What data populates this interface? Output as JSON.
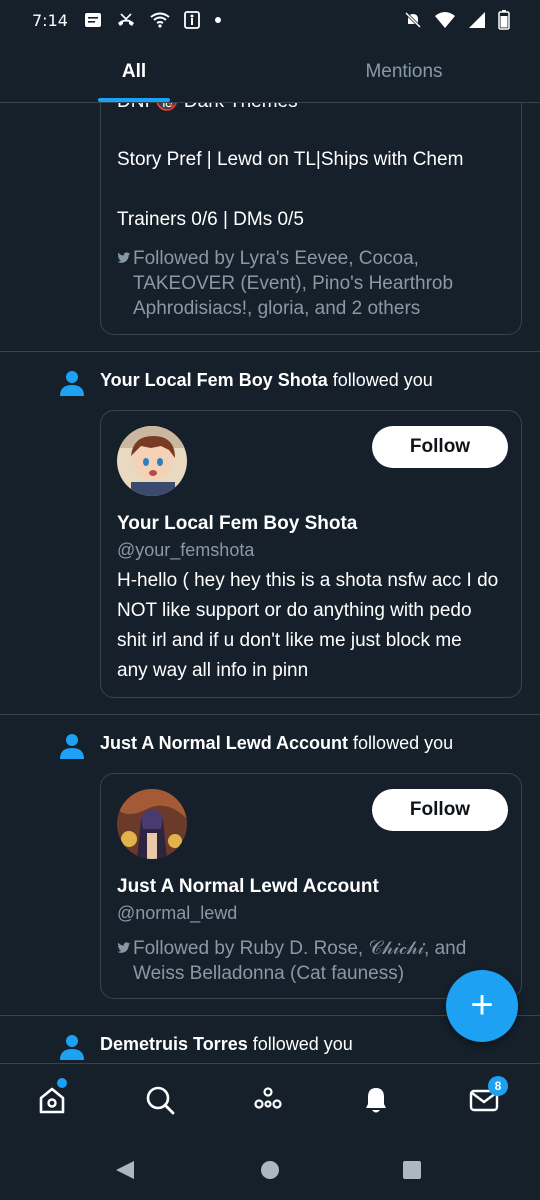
{
  "status_bar": {
    "time": "7:14"
  },
  "tabs": [
    {
      "label": "All"
    },
    {
      "label": "Mentions"
    }
  ],
  "truncated_card": {
    "top_line": "DNI 🔞 Dark Themes",
    "bio_lines": [
      "Story Pref | Lewd on TL|Ships with Chem",
      "Trainers 0/6 | DMs 0/5"
    ],
    "followed_by": [
      "Followed by Lyra's Eevee, Cocoa,",
      "TAKEOVER (Event), Pino's Hearthrob",
      "Aphrodisiacs!, gloria, and 2 others"
    ]
  },
  "notifications": [
    {
      "actor": "Your Local Fem Boy Shota",
      "action": "followed you",
      "card": {
        "name": "Your Local Fem Boy Shota",
        "handle": "@your_femshota",
        "bio_lines": [
          "H-hello ( hey hey this is a shota nsfw acc I do",
          "NOT like support or do anything with pedo",
          "shit irl and if u don't like me just block me",
          "any way all info in pinn"
        ],
        "follow_label": "Follow"
      }
    },
    {
      "actor": "Just A Normal Lewd Account",
      "action": "followed you",
      "card": {
        "name": "Just A Normal Lewd Account",
        "handle": "@normal_lewd",
        "followed_by": [
          "Followed by Ruby D. Rose, 𝒞𝒽𝒾𝒸𝒽𝒾, and",
          "Weiss Belladonna (Cat fauness)"
        ],
        "follow_label": "Follow"
      }
    },
    {
      "actor": "Demetruis Torres",
      "action": "followed you"
    }
  ],
  "fab": {
    "icon": "plus-icon"
  },
  "bottom_nav": {
    "items": [
      "home-icon",
      "search-icon",
      "spaces-icon",
      "bell-icon",
      "mail-icon"
    ],
    "mail_badge": "8"
  },
  "colors": {
    "background": "#15202b",
    "accent": "#1da1f2",
    "border": "#38444d",
    "secondary_text": "#8899a6"
  }
}
